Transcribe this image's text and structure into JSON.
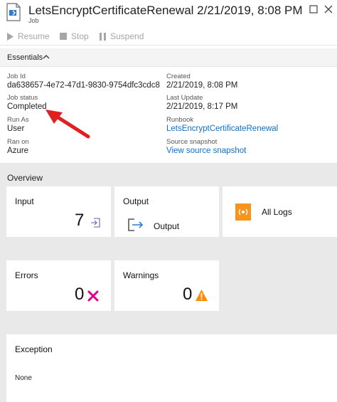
{
  "header": {
    "title": "LetsEncryptCertificateRenewal 2/21/2019, 8:08 PM",
    "subtitle": "Job",
    "icon": "runbook-job-icon"
  },
  "toolbar": {
    "resume_label": "Resume",
    "stop_label": "Stop",
    "suspend_label": "Suspend"
  },
  "essentials": {
    "label": "Essentials",
    "expanded": true
  },
  "properties": {
    "left": [
      {
        "label": "Job Id",
        "value": "da638657-4e72-47d1-9830-9754dfc3cdc8"
      },
      {
        "label": "Job status",
        "value": "Completed"
      },
      {
        "label": "Run As",
        "value": "User"
      },
      {
        "label": "Ran on",
        "value": "Azure"
      }
    ],
    "right": [
      {
        "label": "Created",
        "value": "2/21/2019, 8:08 PM"
      },
      {
        "label": "Last Update",
        "value": "2/21/2019, 8:17 PM"
      },
      {
        "label": "Runbook",
        "value": "LetsEncryptCertificateRenewal"
      },
      {
        "label": "Source snapshot",
        "value": "View source snapshot"
      }
    ]
  },
  "overview": {
    "title": "Overview",
    "input": {
      "title": "Input",
      "count": "7"
    },
    "output": {
      "title": "Output",
      "label": "Output"
    },
    "all_logs": {
      "label": "All Logs"
    },
    "errors": {
      "title": "Errors",
      "count": "0"
    },
    "warnings": {
      "title": "Warnings",
      "count": "0"
    },
    "exception": {
      "title": "Exception",
      "value": "None"
    }
  },
  "colors": {
    "accent_blue": "#1070c8",
    "error_pink": "#e3008c",
    "warning_orange": "#ff8c00",
    "logs_orange": "#f7941d",
    "annotation_red": "#e02020"
  }
}
